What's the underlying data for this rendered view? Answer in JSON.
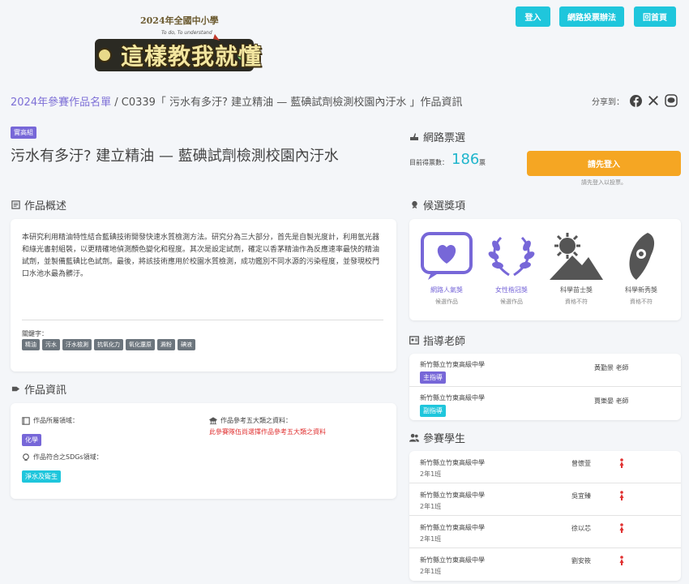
{
  "header": {
    "logo_year": "2024年全國中小學",
    "logo_subtitle": "To do, To understand",
    "logo_title": "這樣教我就懂",
    "buttons": [
      "登入",
      "網路投票辦法",
      "回首頁"
    ]
  },
  "breadcrumb": {
    "link": "2024年參賽作品名單",
    "separator": "/",
    "current": "C0339「 污水有多汙? 建立精油 — 藍碘試劑檢測校園內汙水 」作品資訊"
  },
  "share": {
    "label": "分享到：",
    "icons": [
      "facebook-icon",
      "x-icon",
      "line-icon"
    ]
  },
  "project": {
    "category": "實高組",
    "title": "污水有多汙? 建立精油 — 藍碘試劑檢測校園內汙水"
  },
  "overview": {
    "heading": "作品概述",
    "abstract": "本研究利用精油特性結合藍碘技術開發快速水質檢測方法。研究分為三大部分，首先是自製光度計，利用氫光器和綠光書射組裝，以更精確地偵測顏色變化和程度。其次是設定試劑，確定以香茅精油作為反應速率最快的精油試劑，並製備藍碘比色試劑。最後，將該技術應用於校園水質檢測，成功鑑別不同水源的污染程度，並發現校門口水池水最為髒汙。",
    "keywords_label": "關鍵字：",
    "keywords": [
      "精油",
      "污水",
      "汙水檢測",
      "抗氧化力",
      "氧化還原",
      "澱粉",
      "碘液"
    ]
  },
  "info": {
    "heading": "作品資訊",
    "field_label": "作品所屬領域：",
    "field_value": "化學",
    "sdgs_label": "作品符合之SDGs領域：",
    "sdgs_value": "淨水及衛生",
    "ref_label": "作品參考五大類之資料：",
    "ref_warning": "此參賽隊伍尚選擇作品參考五大類之資料"
  },
  "vote": {
    "heading": "網路票選",
    "current_label": "目前得票數：",
    "count": "186",
    "unit": "票",
    "login_button": "請先登入",
    "login_note": "請先登入以投票。"
  },
  "awards": {
    "heading": "候選獎項",
    "items": [
      {
        "name": "網路人氣獎",
        "status": "候選作品",
        "active": true,
        "color": "#7767d8"
      },
      {
        "name": "女性楷冠獎",
        "status": "候選作品",
        "active": true,
        "color": "#7767d8"
      },
      {
        "name": "科學苗士獎",
        "status": "資格不符",
        "active": false,
        "color": "#555555"
      },
      {
        "name": "科學新秀獎",
        "status": "資格不符",
        "active": false,
        "color": "#555555"
      }
    ]
  },
  "teachers": {
    "heading": "指導老師",
    "items": [
      {
        "school": "新竹縣立竹東高級中學",
        "name": "黃勤景 老師",
        "role": "主指導"
      },
      {
        "school": "新竹縣立竹東高級中學",
        "name": "賈樂晏 老師",
        "role": "副指導"
      }
    ]
  },
  "students": {
    "heading": "參賽學生",
    "items": [
      {
        "school": "新竹縣立竹東高級中學",
        "grade": "2年1班",
        "name": "曾懷萱"
      },
      {
        "school": "新竹縣立竹東高級中學",
        "grade": "2年1班",
        "name": "吳宜臻"
      },
      {
        "school": "新竹縣立竹東高級中學",
        "grade": "2年1班",
        "name": "徐以芯"
      },
      {
        "school": "新竹縣立竹東高級中學",
        "grade": "2年1班",
        "name": "劉安筱"
      }
    ]
  },
  "colors": {
    "accent": "#7767d8",
    "cyan": "#1fc6dc",
    "orange": "#f5a623",
    "female": "#e03131"
  }
}
